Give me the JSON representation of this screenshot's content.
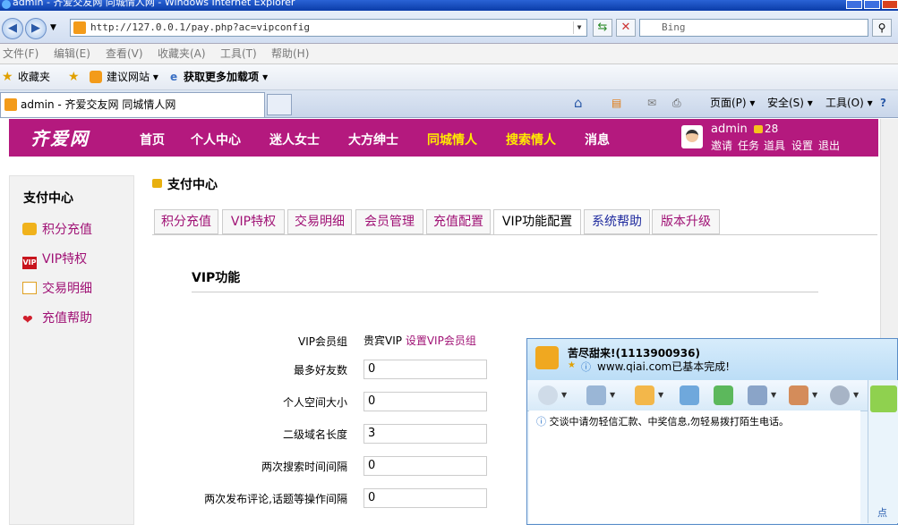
{
  "browser": {
    "window_title": "admin - 齐爱交友网 同城情人网 - Windows Internet Explorer",
    "url": "http://127.0.0.1/pay.php?ac=vipconfig",
    "search_placeholder": "Bing",
    "menu": [
      "文件(F)",
      "编辑(E)",
      "查看(V)",
      "收藏夹(A)",
      "工具(T)",
      "帮助(H)"
    ],
    "favorites": {
      "label": "收藏夹",
      "suggested": "建议网站 ▾",
      "get_more": "获取更多加载项 ▾"
    },
    "tab_title": "admin - 齐爱交友网 同城情人网",
    "commands": {
      "page": "页面(P) ▾",
      "safety": "安全(S) ▾",
      "tools": "工具(O) ▾"
    }
  },
  "site": {
    "logo": "齐爱网",
    "nav": [
      "首页",
      "个人中心",
      "迷人女士",
      "大方绅士",
      "同城情人",
      "搜索情人",
      "消息"
    ],
    "user": {
      "name": "admin",
      "coins": "28",
      "links": [
        "邀请",
        "任务",
        "道具",
        "设置",
        "退出"
      ]
    }
  },
  "sidebar": {
    "title": "支付中心",
    "items": [
      {
        "label": "积分充值",
        "icon": "coins-icon"
      },
      {
        "label": "VIP特权",
        "icon": "vip-icon"
      },
      {
        "label": "交易明细",
        "icon": "ledger-icon"
      },
      {
        "label": "充值帮助",
        "icon": "heart-icon"
      }
    ]
  },
  "main": {
    "title": "支付中心",
    "tabs": [
      "积分充值",
      "VIP特权",
      "交易明细",
      "会员管理",
      "充值配置",
      "VIP功能配置",
      "系统帮助",
      "版本升级"
    ],
    "active_tab": "VIP功能配置",
    "section_title": "VIP功能",
    "form": {
      "vip_group_label": "VIP会员组",
      "vip_group_value": "贵宾VIP",
      "vip_group_link": "设置VIP会员组",
      "fields": [
        {
          "label": "最多好友数",
          "value": "0"
        },
        {
          "label": "个人空间大小",
          "value": "0"
        },
        {
          "label": "二级域名长度",
          "value": "3"
        },
        {
          "label": "两次搜索时间间隔",
          "value": "0"
        },
        {
          "label": "两次发布评论,话题等操作间隔",
          "value": "0"
        }
      ]
    }
  },
  "popup": {
    "name": "苦尽甜来!(1113900936)",
    "status": "www.qiai.com已基本完成!",
    "warning": "交谈中请勿轻信汇款、中奖信息,勿轻易拨打陌生电话。",
    "side_text": "点"
  }
}
